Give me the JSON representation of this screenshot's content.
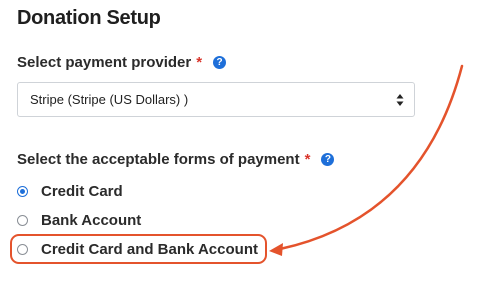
{
  "page": {
    "title": "Donation Setup"
  },
  "payment_provider": {
    "label": "Select payment provider",
    "required_marker": "*",
    "selected_value": "Stripe (Stripe (US Dollars) )"
  },
  "payment_forms": {
    "label": "Select the acceptable forms of payment",
    "required_marker": "*",
    "options": [
      {
        "label": "Credit Card",
        "selected": true
      },
      {
        "label": "Bank Account",
        "selected": false
      },
      {
        "label": "Credit Card and Bank Account",
        "selected": false
      }
    ]
  },
  "annotation": {
    "highlighted_option": "Credit Card and Bank Account",
    "color": "#e4532c"
  },
  "colors": {
    "accent": "#1e6fd9",
    "required": "#d9342b"
  },
  "icons": {
    "help": "question-circle-icon",
    "select_arrows": "chevron-up-down-icon"
  }
}
